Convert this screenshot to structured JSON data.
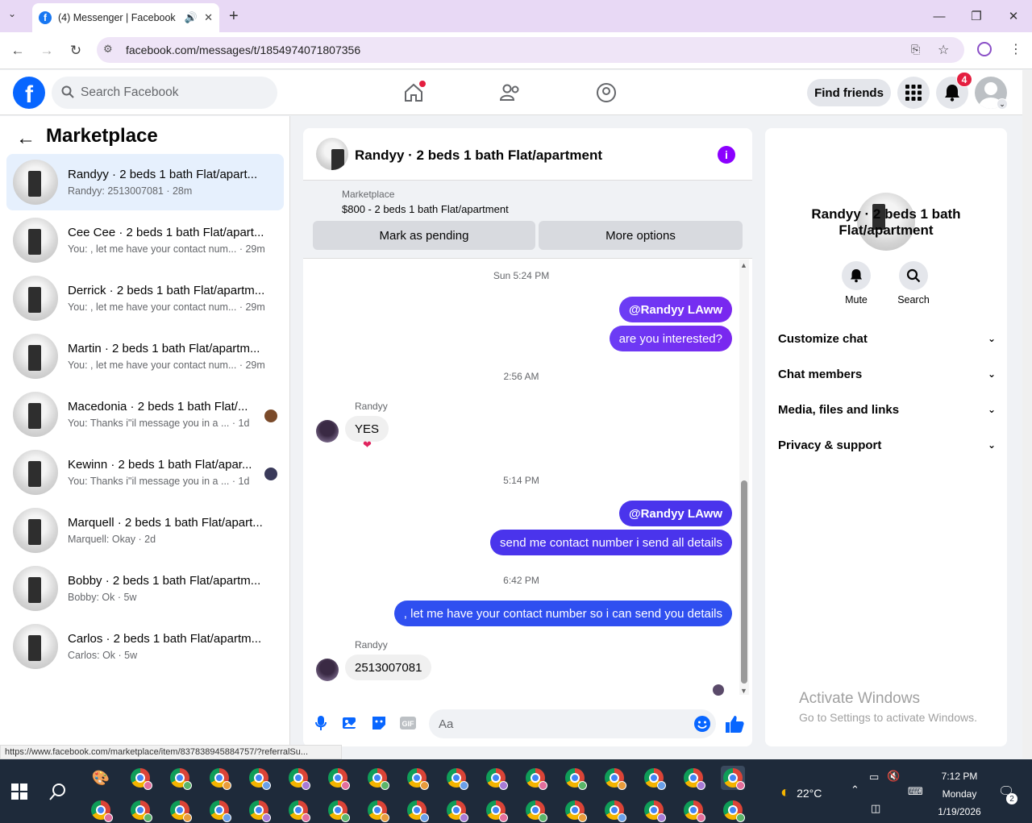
{
  "browser": {
    "tab_title": "(4) Messenger | Facebook",
    "url": "facebook.com/messages/t/1854974071807356",
    "status_url": "https://www.facebook.com/marketplace/item/837838945884757/?referralSu..."
  },
  "header": {
    "logo": "f",
    "search_placeholder": "Search Facebook",
    "find_friends": "Find friends",
    "notification_count": "4"
  },
  "sidebar": {
    "back": "←",
    "title": "Marketplace",
    "conversations": [
      {
        "name": "Randyy · 2 beds 1 bath Flat/apart...",
        "sub": "Randyy: 2513007081 · 28m",
        "active": true
      },
      {
        "name": "Cee Cee · 2 beds 1 bath Flat/apart...",
        "sub": "You: , let me have your contact num... · 29m"
      },
      {
        "name": "Derrick · 2 beds 1 bath Flat/apartm...",
        "sub": "You: , let me have your contact num... · 29m"
      },
      {
        "name": "Martin · 2 beds 1 bath Flat/apartm...",
        "sub": "You: , let me have your contact num... · 29m"
      },
      {
        "name": "Macedonia · 2 beds 1 bath Flat/...",
        "sub": "You: Thanks i\"il message you in a ...  · 1d"
      },
      {
        "name": "Kewinn · 2 beds 1 bath Flat/apar...",
        "sub": "You: Thanks i\"il message you in a ...  · 1d"
      },
      {
        "name": "Marquell · 2 beds 1 bath Flat/apart...",
        "sub": "Marquell: Okay · 2d"
      },
      {
        "name": "Bobby · 2 beds 1 bath Flat/apartm...",
        "sub": "Bobby: Ok · 5w"
      },
      {
        "name": "Carlos · 2 beds 1 bath Flat/apartm...",
        "sub": "Carlos: Ok · 5w"
      }
    ]
  },
  "chat": {
    "title": "Randyy · 2 beds 1 bath Flat/apartment",
    "marketplace_label": "Marketplace",
    "listing": "$800 - 2 beds 1 bath Flat/apartment",
    "mark_pending": "Mark as pending",
    "more_options": "More options",
    "ts1": "Sun 5:24 PM",
    "m1": "@Randyy LAww",
    "m2": "are you interested?",
    "ts2": "2:56 AM",
    "sender1": "Randyy",
    "in1": "YES",
    "ts3": "5:14 PM",
    "m3": "@Randyy LAww",
    "m4": "send me contact number i send all details",
    "ts4": "6:42 PM",
    "m5": ", let me have your contact number so i can send you details",
    "sender2": "Randyy",
    "in2": "2513007081",
    "composer_placeholder": "Aa"
  },
  "info": {
    "title": "Randyy · 2 beds 1 bath Flat/apartment",
    "mute": "Mute",
    "search": "Search",
    "rows": [
      "Customize chat",
      "Chat members",
      "Media, files and links",
      "Privacy & support"
    ],
    "activate_title": "Activate Windows",
    "activate_sub": "Go to Settings to activate Windows."
  },
  "taskbar": {
    "temp": "22°C",
    "time": "7:12 PM",
    "day": "Monday",
    "date": "1/19/2026",
    "notif_count": "2"
  }
}
